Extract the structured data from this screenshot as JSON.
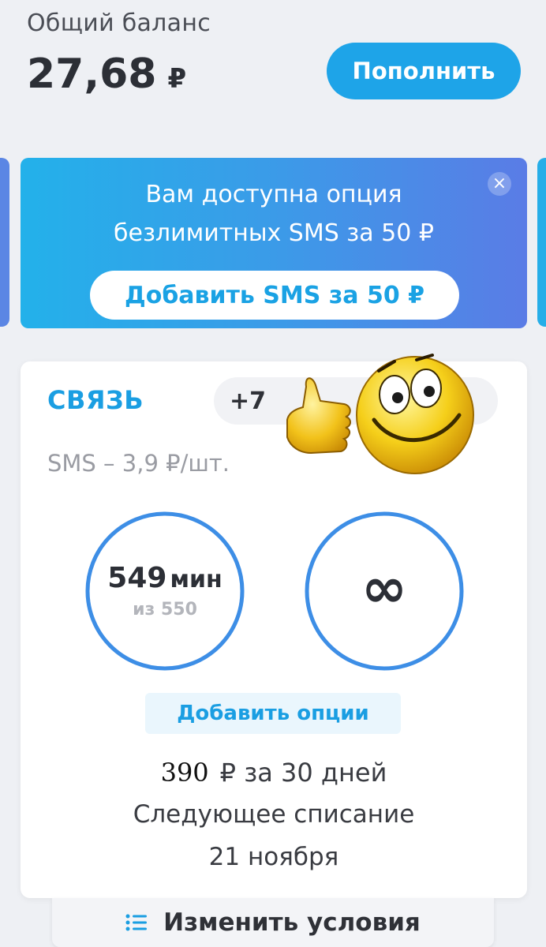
{
  "header": {
    "balance_label": "Общий баланс",
    "balance_value": "27,68",
    "currency": "₽",
    "topup_label": "Пополнить"
  },
  "promo": {
    "line1": "Вам доступна опция",
    "line2": "безлимитных SMS за 50 ₽",
    "close": "×",
    "action_label": "Добавить SMS за  50 ₽"
  },
  "tariff": {
    "title": "СВЯЗЬ",
    "extra_badge": "+7",
    "sms_price": "SMS – 3,9 ₽/шт.",
    "minutes_value": "549",
    "minutes_unit": "мин",
    "minutes_total": "из 550",
    "minutes_fraction": 0.998,
    "internet_value": "∞",
    "add_options_label": "Добавить опции",
    "price_number": "390",
    "price_rest": "₽ за 30 дней",
    "next_charge_label": "Следующее списание",
    "next_charge_date": "21 ноября"
  },
  "footer": {
    "change_terms_label": "Изменить условия"
  },
  "colors": {
    "accent": "#1ea4e8",
    "ring": "#3d8ee6",
    "banner_start": "#23b1ea",
    "banner_end": "#5a7ce6"
  },
  "icons": {
    "close": "close-icon",
    "list": "list-icon",
    "sticker": "thumbs-up-smiley-sticker"
  }
}
